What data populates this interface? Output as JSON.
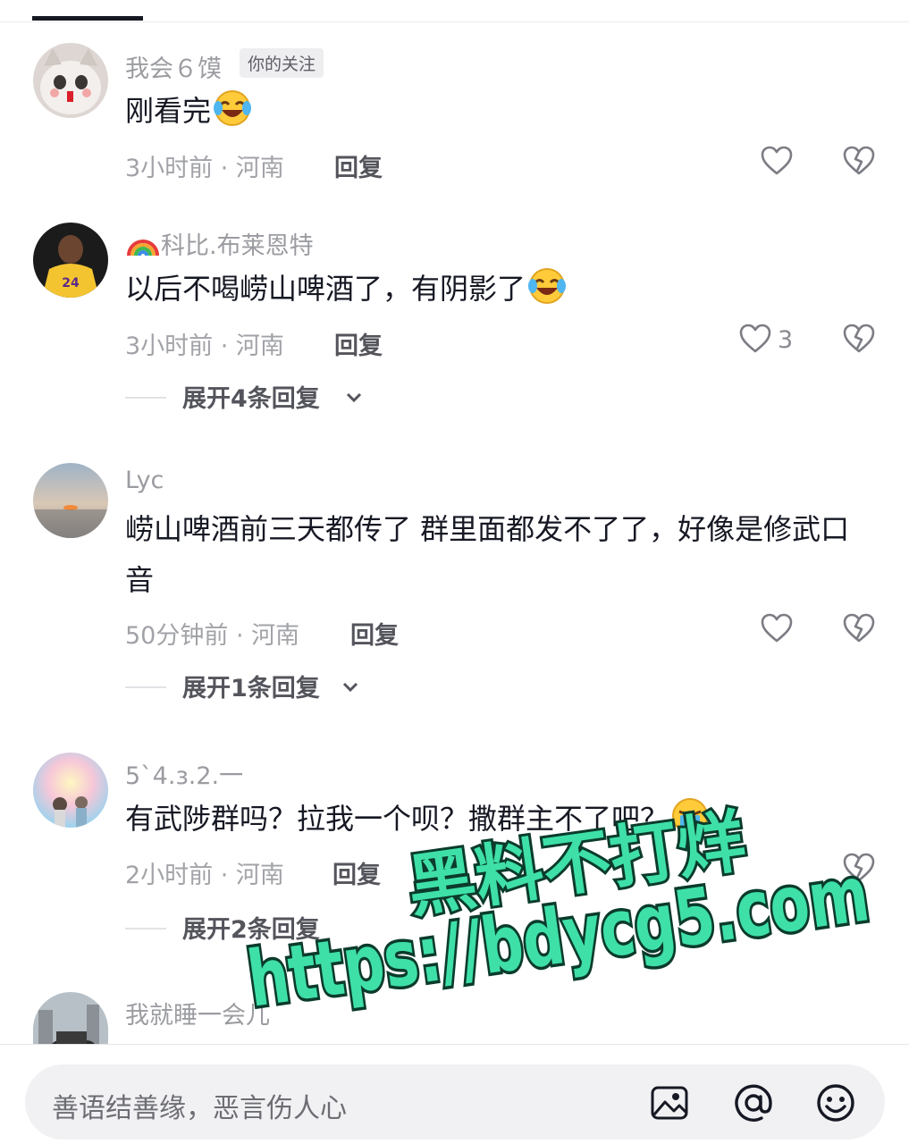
{
  "comments": [
    {
      "username": "我会６馍",
      "badge": "你的关注",
      "text": "刚看完",
      "emoji": "laugh-cry",
      "time": "3小时前",
      "location": "河南",
      "meta": "3小时前 · 河南",
      "reply_label": "回复",
      "likes": ""
    },
    {
      "username_prefix_icon": "rainbow-icon",
      "username": "科比.布莱恩特",
      "text": "以后不喝崂山啤酒了，有阴影了",
      "emoji": "laugh-cry",
      "meta": "3小时前 · 河南",
      "reply_label": "回复",
      "likes": "3",
      "expand_label": "展开4条回复"
    },
    {
      "username": "Lyc",
      "text": "崂山啤酒前三天都传了 群里面都发不了了，好像是修武口音",
      "meta": "50分钟前 · 河南",
      "reply_label": "回复",
      "likes": "",
      "expand_label": "展开1条回复"
    },
    {
      "username": "5`4.з.2.一",
      "text": "有武陟群吗？拉我一个呗？撒群主不了吧？",
      "emoji": "crying",
      "meta": "2小时前 · 河南",
      "reply_label": "回复",
      "likes": "",
      "expand_label": "展开2条回复"
    },
    {
      "username": "我就睡一会儿"
    }
  ],
  "input": {
    "placeholder": "善语结善缘，恶言伤人心"
  },
  "tools": [
    "image-icon",
    "at-icon",
    "emoji-icon"
  ],
  "watermark": {
    "line1": "黑料不打烊",
    "line2": "https://bdycg5.com",
    "color": "#3ee0a8"
  }
}
